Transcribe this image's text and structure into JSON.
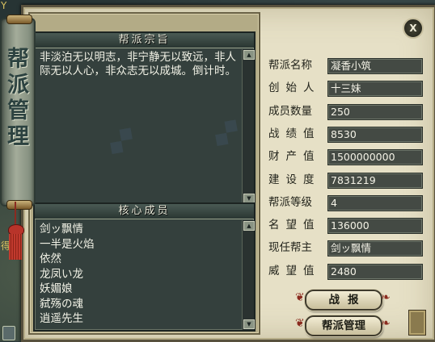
{
  "window": {
    "title": "帮派管理",
    "close_label": "X"
  },
  "manifesto": {
    "header": "帮派宗旨",
    "text": "非淡泊无以明志，非宁静无以致远，非人际无以人心，非众志无以成城。倒计时。"
  },
  "members": {
    "header": "核心成员",
    "items": [
      "剑ッ飘情",
      "一半是火焰",
      "依然",
      "龙凤い龙",
      "妖媚娘",
      "弑殇の魂",
      "逍遥先生"
    ]
  },
  "info": {
    "rows": [
      {
        "label": "帮派名称",
        "value": "凝香小筑"
      },
      {
        "label": "创始人",
        "value": "十三妹"
      },
      {
        "label": "成员数量",
        "value": "250"
      },
      {
        "label": "战绩值",
        "value": "8530"
      },
      {
        "label": "财产值",
        "value": "1500000000"
      },
      {
        "label": "建设度",
        "value": "7831219"
      },
      {
        "label": "帮派等级",
        "value": "4"
      },
      {
        "label": "名望值",
        "value": "136000"
      },
      {
        "label": "现任帮主",
        "value": "剑ッ飘情"
      },
      {
        "label": "威望值",
        "value": "2480"
      }
    ]
  },
  "buttons": {
    "battle_report": "战报",
    "guild_manage": "帮派管理"
  },
  "edge_text": {
    "top": "Y",
    "left": "得"
  },
  "icons": {
    "scroll_up": "▲",
    "scroll_down": "▼",
    "btn_deco_left": "❦",
    "btn_deco_right": "❧"
  },
  "colors": {
    "parchment": "#e6e0c6",
    "dark_panel": "#34403d",
    "value_box": "#444a44"
  }
}
